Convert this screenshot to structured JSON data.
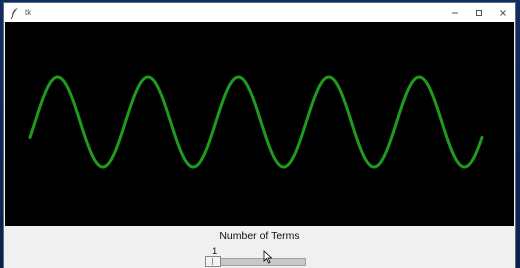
{
  "window": {
    "title": "tk",
    "controls": [
      "minimize",
      "maximize",
      "close"
    ]
  },
  "canvas": {
    "background": "#000000",
    "wave_color": "#1f9a1f",
    "periods_visible": 5
  },
  "slider": {
    "label": "Number of Terms",
    "value": "1",
    "min": 1,
    "max": 100,
    "position_fraction": 0.02
  },
  "icons": {
    "app": "feather-icon",
    "minimize": "minimize-icon",
    "maximize": "maximize-icon",
    "close": "close-icon"
  }
}
